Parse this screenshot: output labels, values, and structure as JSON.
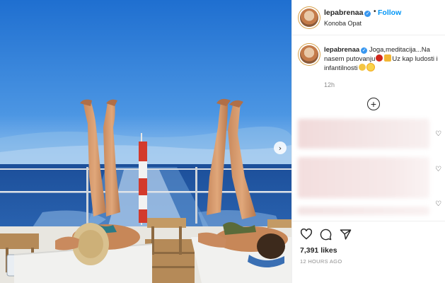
{
  "post": {
    "image_alt": "Two women lying on sun loungers on a boat deck with legs raised against the sea and sky",
    "carousel_next_icon": "chevron-right-icon"
  },
  "header": {
    "username": "lepabrenaa",
    "separator": "•",
    "follow_label": "Follow",
    "location": "Konoba Opat"
  },
  "caption": {
    "username": "lepabrenaa",
    "text_1": "Joga,meditacija...Na nasem putovanju",
    "text_2": "Uz kap ludosti i infantilnosti",
    "time_ago": "12h"
  },
  "comments": {
    "load_more_icon": "plus-circle-icon"
  },
  "actions": {
    "likes": "7,391 likes",
    "posted": "12 HOURS AGO"
  },
  "colors": {
    "accent_blue": "#0095f6",
    "verified_blue": "#3897f0",
    "secondary_text": "#8e8e8e"
  }
}
